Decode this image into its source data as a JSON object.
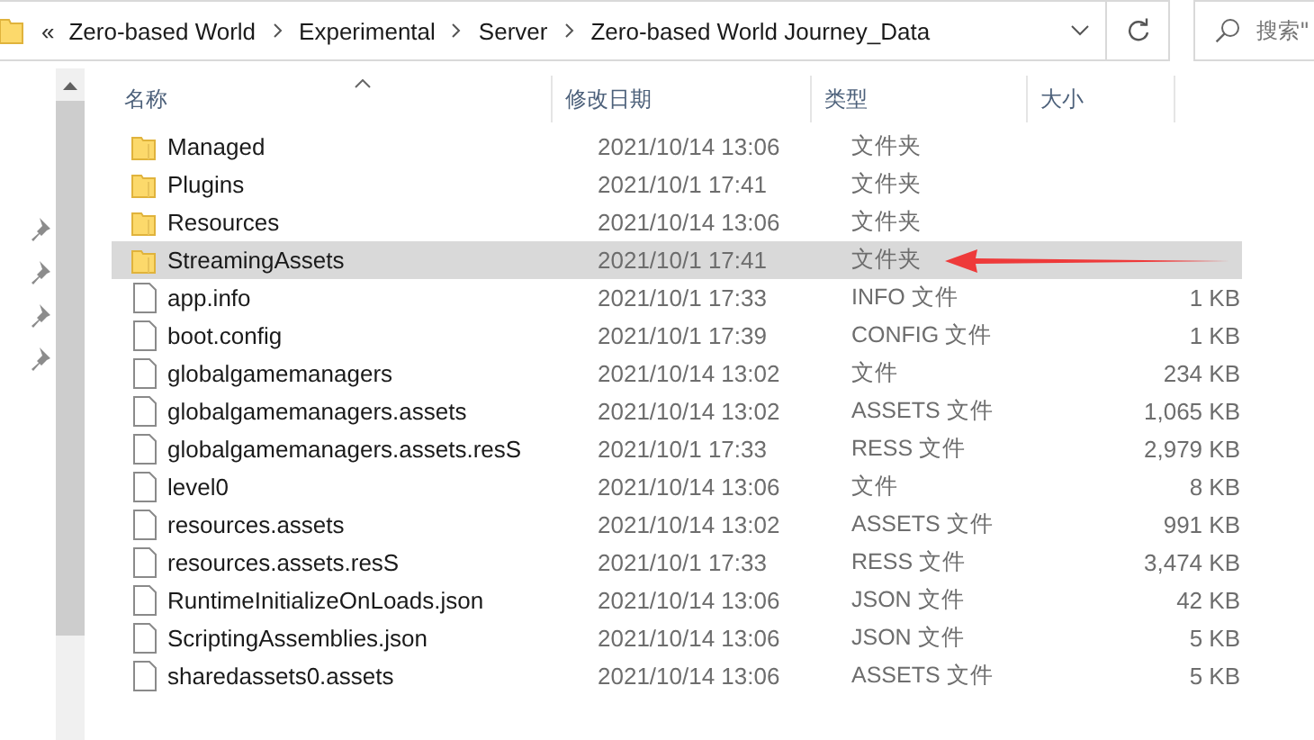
{
  "address_bar": {
    "overflow": "«",
    "path": [
      "Zero-based World",
      "Experimental",
      "Server",
      "Zero-based World Journey_Data"
    ]
  },
  "search": {
    "placeholder": "搜索\""
  },
  "columns": [
    {
      "label": "名称",
      "sorted": true
    },
    {
      "label": "修改日期",
      "sorted": false
    },
    {
      "label": "类型",
      "sorted": false
    },
    {
      "label": "大小",
      "sorted": false
    }
  ],
  "rows": [
    {
      "name": "Managed",
      "date": "2021/10/14 13:06",
      "type": "文件夹",
      "kind": "folder",
      "selected": false,
      "annotated": false
    },
    {
      "name": "Plugins",
      "date": "2021/10/1 17:41",
      "type": "文件夹",
      "kind": "folder",
      "selected": false,
      "annotated": false
    },
    {
      "name": "Resources",
      "date": "2021/10/14 13:06",
      "type": "文件夹",
      "kind": "folder",
      "selected": false,
      "annotated": false
    },
    {
      "name": "StreamingAssets",
      "date": "2021/10/1 17:41",
      "type": "文件夹",
      "kind": "folder",
      "selected": true,
      "annotated": true
    },
    {
      "name": "app.info",
      "date": "2021/10/1 17:33",
      "type": "INFO 文件",
      "size": "1 KB",
      "kind": "file",
      "selected": false,
      "annotated": false
    },
    {
      "name": "boot.config",
      "date": "2021/10/1 17:39",
      "type": "CONFIG 文件",
      "size": "1 KB",
      "kind": "file",
      "selected": false,
      "annotated": false
    },
    {
      "name": "globalgamemanagers",
      "date": "2021/10/14 13:02",
      "type": "文件",
      "size": "234 KB",
      "kind": "file",
      "selected": false,
      "annotated": false
    },
    {
      "name": "globalgamemanagers.assets",
      "date": "2021/10/14 13:02",
      "type": "ASSETS 文件",
      "size": "1,065 KB",
      "kind": "file",
      "selected": false,
      "annotated": false
    },
    {
      "name": "globalgamemanagers.assets.resS",
      "date": "2021/10/1 17:33",
      "type": "RESS 文件",
      "size": "2,979 KB",
      "kind": "file",
      "selected": false,
      "annotated": false
    },
    {
      "name": "level0",
      "date": "2021/10/14 13:06",
      "type": "文件",
      "size": "8 KB",
      "kind": "file",
      "selected": false,
      "annotated": false
    },
    {
      "name": "resources.assets",
      "date": "2021/10/14 13:02",
      "type": "ASSETS 文件",
      "size": "991 KB",
      "kind": "file",
      "selected": false,
      "annotated": false
    },
    {
      "name": "resources.assets.resS",
      "date": "2021/10/1 17:33",
      "type": "RESS 文件",
      "size": "3,474 KB",
      "kind": "file",
      "selected": false,
      "annotated": false
    },
    {
      "name": "RuntimeInitializeOnLoads.json",
      "date": "2021/10/14 13:06",
      "type": "JSON 文件",
      "size": "42 KB",
      "kind": "file",
      "selected": false,
      "annotated": false
    },
    {
      "name": "ScriptingAssemblies.json",
      "date": "2021/10/14 13:06",
      "type": "JSON 文件",
      "size": "5 KB",
      "kind": "file",
      "selected": false,
      "annotated": false
    },
    {
      "name": "sharedassets0.assets",
      "date": "2021/10/14 13:06",
      "type": "ASSETS 文件",
      "size": "5 KB",
      "kind": "file",
      "selected": false,
      "annotated": false
    }
  ]
}
